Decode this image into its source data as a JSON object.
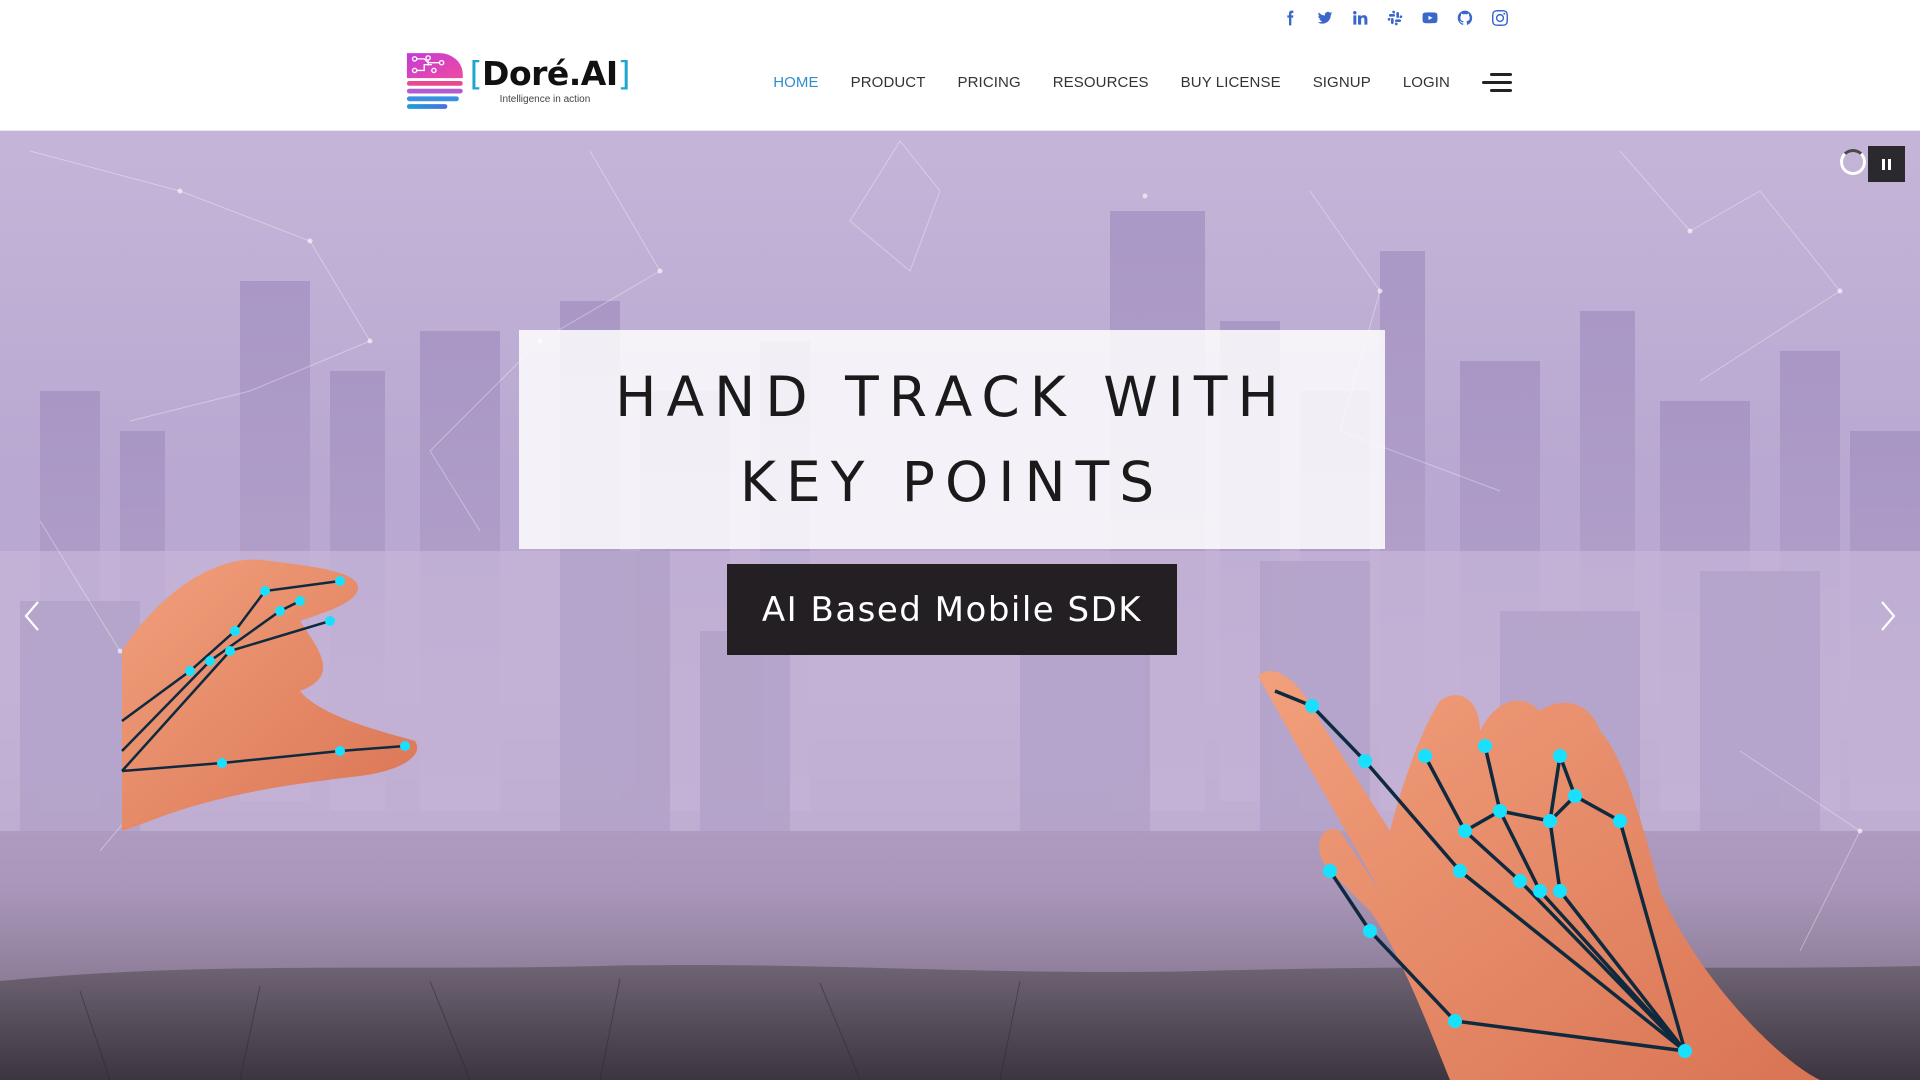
{
  "social": {
    "items": [
      {
        "name": "facebook",
        "icon": "facebook-icon"
      },
      {
        "name": "twitter",
        "icon": "twitter-icon"
      },
      {
        "name": "linkedin",
        "icon": "linkedin-icon"
      },
      {
        "name": "slack",
        "icon": "slack-icon"
      },
      {
        "name": "youtube",
        "icon": "youtube-icon"
      },
      {
        "name": "github",
        "icon": "github-icon"
      },
      {
        "name": "instagram",
        "icon": "instagram-icon"
      }
    ],
    "color": "#3a68c9"
  },
  "header": {
    "logo": {
      "wordmark": "Doré.AI",
      "bracket_open": "[",
      "bracket_close": "]",
      "tagline": "Intelligence in action"
    },
    "nav": {
      "items": [
        {
          "label": "HOME",
          "active": true
        },
        {
          "label": "PRODUCT",
          "active": false
        },
        {
          "label": "PRICING",
          "active": false
        },
        {
          "label": "RESOURCES",
          "active": false
        },
        {
          "label": "BUY LICENSE",
          "active": false
        },
        {
          "label": "SIGNUP",
          "active": false
        },
        {
          "label": "LOGIN",
          "active": false
        }
      ],
      "active_color": "#2f8fce",
      "menu_icon": "hamburger-menu-icon"
    }
  },
  "hero": {
    "slide": {
      "title": "HAND TRACK WITH KEY POINTS",
      "subtitle": "AI Based Mobile SDK"
    },
    "controls": {
      "prev_icon": "chevron-left-icon",
      "next_icon": "chevron-right-icon",
      "pause_icon": "pause-icon",
      "loader_icon": "loading-spinner-icon"
    },
    "colors": {
      "keypoint": "#19e0ff",
      "skeleton": "#0f2a3f",
      "skin": "#e98d6a"
    }
  }
}
